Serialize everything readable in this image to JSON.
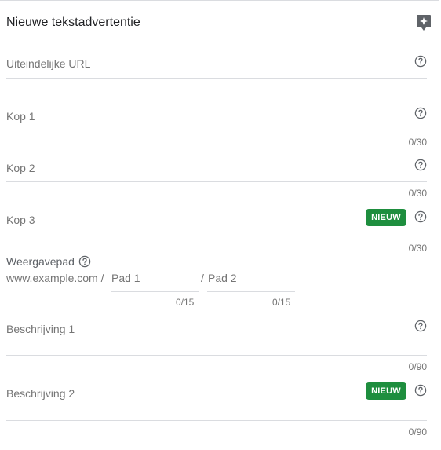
{
  "header": {
    "title": "Nieuwe tekstadvertentie",
    "feedback_icon": "feedback-icon"
  },
  "fields": {
    "final_url": {
      "label": "Uiteindelijke URL"
    },
    "headline1": {
      "label": "Kop 1",
      "counter": "0/30"
    },
    "headline2": {
      "label": "Kop 2",
      "counter": "0/30"
    },
    "headline3": {
      "label": "Kop 3",
      "badge": "NIEUW",
      "counter": "0/30"
    },
    "display_path": {
      "label": "Weergavepad",
      "domain": "www.example.com /",
      "path1_placeholder": "Pad 1",
      "path2_prefix": "/",
      "path2_placeholder": "Pad 2",
      "path1_counter": "0/15",
      "path2_counter": "0/15"
    },
    "description1": {
      "label": "Beschrijving 1",
      "counter": "0/90"
    },
    "description2": {
      "label": "Beschrijving 2",
      "badge": "NIEUW",
      "counter": "0/90"
    }
  },
  "colors": {
    "badge": "#1e8e3e",
    "label": "#757575",
    "divider": "#dadce0"
  }
}
